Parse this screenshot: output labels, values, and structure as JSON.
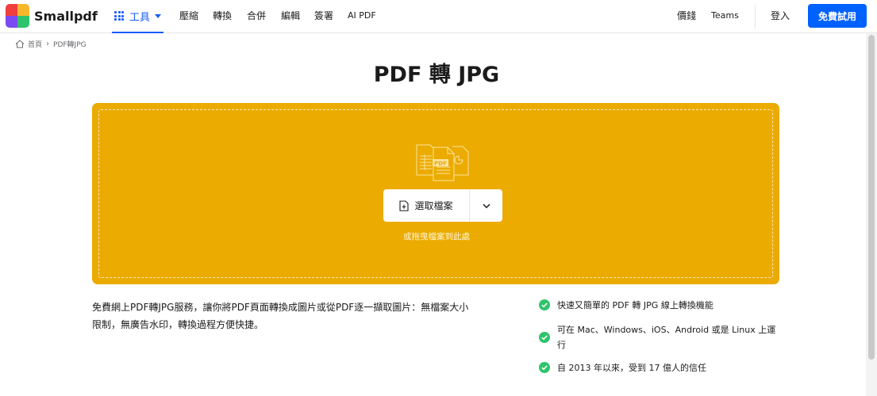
{
  "navbar": {
    "brand": "Smallpdf",
    "tools_label": "工具",
    "links": [
      "壓縮",
      "轉換",
      "合併",
      "編輯",
      "簽署",
      "AI PDF"
    ],
    "pricing": "價錢",
    "teams": "Teams",
    "login": "登入",
    "trial": "免費試用"
  },
  "breadcrumb": {
    "home": "首頁",
    "current": "PDF轉JPG"
  },
  "page": {
    "title": "PDF 轉 JPG"
  },
  "dropzone": {
    "illustration_label": "PDF",
    "choose_label": "選取檔案",
    "hint": "或拖曳檔案到此處"
  },
  "description": "免費網上PDF轉JPG服務，讓你將PDF頁面轉換成圖片或從PDF逐一擷取圖片：無檔案大小限制，無廣告水印，轉換過程方便快捷。",
  "features": [
    "快速又簡單的 PDF 轉 JPG 線上轉換機能",
    "可在 Mac、Windows、iOS、Android 或是 Linux 上運行",
    "自 2013 年以來，受到 17 億人的信任"
  ],
  "colors": {
    "accent": "#1a5cff",
    "primary_button": "#0061fe",
    "dropzone": "#ebab00",
    "check": "#2fc36a"
  }
}
